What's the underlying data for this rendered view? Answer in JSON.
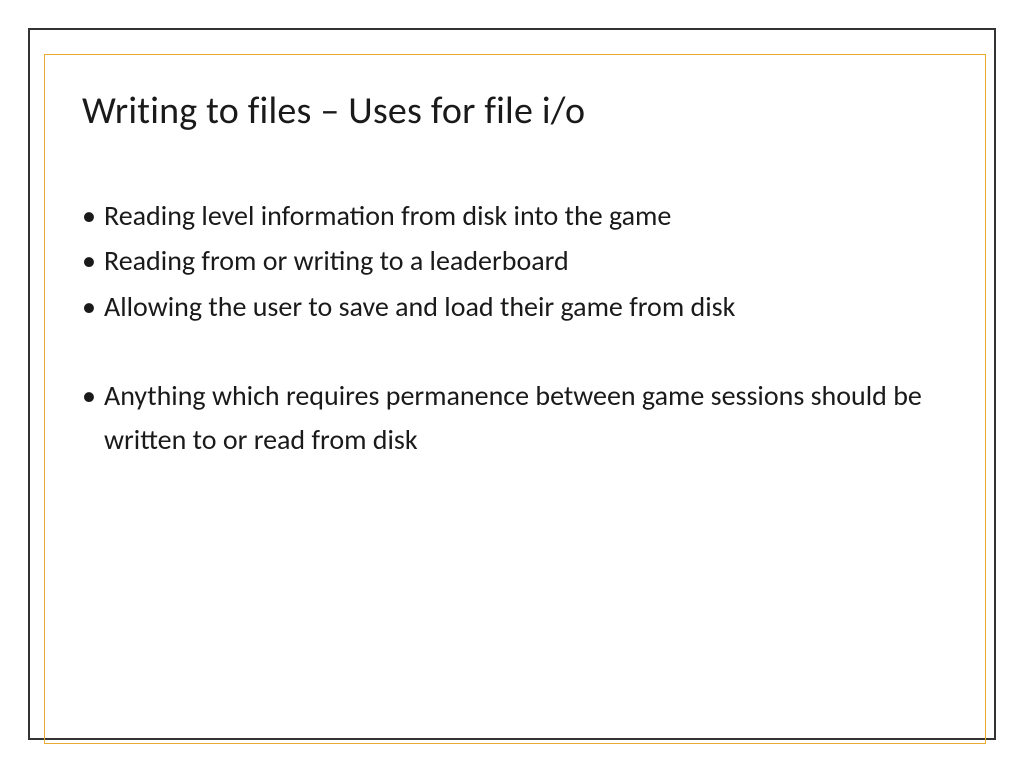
{
  "slide": {
    "title": "Writing to files – Uses for file i/o",
    "bullets": {
      "b1": "Reading level information from disk into the game",
      "b2": "Reading from or writing to a leaderboard",
      "b3": "Allowing the user to save and load their game from disk",
      "b4": "Anything which requires permanence between game sessions should be written to or read from disk"
    }
  }
}
